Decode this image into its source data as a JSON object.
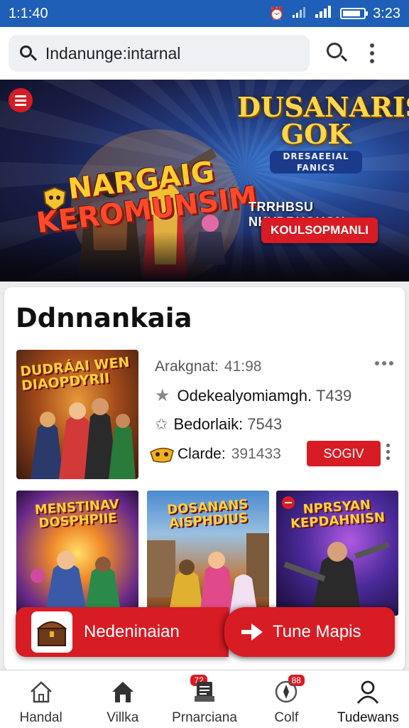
{
  "status_bar": {
    "time_left": "1:1:40",
    "time_right": "3:23",
    "battery_level": 0.85
  },
  "address_bar": {
    "url": "Indanunge:intarnal"
  },
  "hero": {
    "title_line1": "NARGAIG",
    "title_line2": "KEROMUNSIM",
    "logo_line1": "DUSANARIS",
    "logo_line2": "GOK",
    "logo_sub": "DRESAEEIAL FANICS",
    "tagline": "TRRHBSU NKVDRHGUGN",
    "cta": "KOULSOPMANLI"
  },
  "section": {
    "title": "Ddnnankaia",
    "featured": {
      "thumb_title": "DUDRÁAI WEN DIAOPDYRII",
      "rating_label": "Arakgnat:",
      "rating_value": "41:98",
      "row2_label": "Odekealyomiamgh.",
      "row2_value": "T439",
      "row3_label": "Bedorlaik:",
      "row3_value": "7543",
      "row4_label": "Clarde:",
      "row4_value": "391433",
      "button": "SOGIV"
    },
    "grid": [
      {
        "title": "MENSTINAV DOSPHPIIE"
      },
      {
        "title": "DOSANANS AISPHDIUS"
      },
      {
        "title": "NPRSYAN KEPDAHNISN"
      }
    ]
  },
  "action_bar": {
    "left_label": "Nedeninaian",
    "right_label": "Tune Mapis"
  },
  "bottom_nav": [
    {
      "label": "Handal",
      "icon": "home-icon"
    },
    {
      "label": "Villka",
      "icon": "house-filled-icon"
    },
    {
      "label": "Prnarciana",
      "icon": "document-icon",
      "badge": "72"
    },
    {
      "label": "Colf",
      "icon": "compass-icon",
      "badge": "88"
    },
    {
      "label": "Tudewans",
      "icon": "profile-icon"
    }
  ],
  "colors": {
    "accent": "#d71c24",
    "status_bar": "#1f5fb8"
  }
}
